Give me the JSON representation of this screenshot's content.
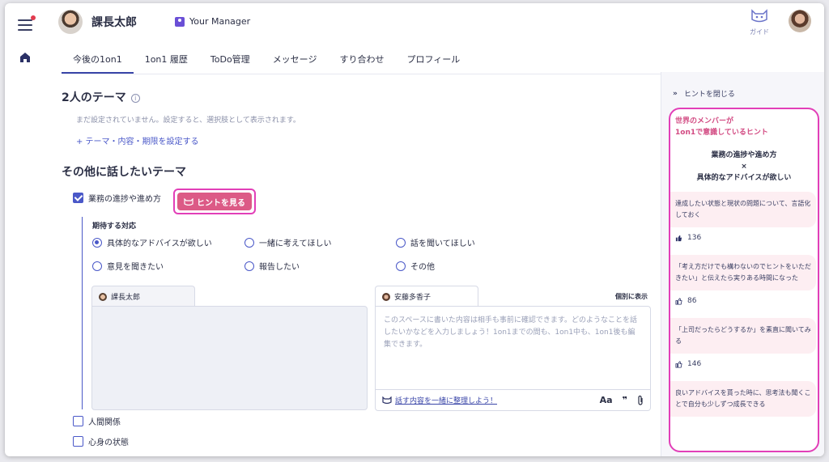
{
  "header": {
    "user_name": "課長太郎",
    "manager_label": "Your Manager",
    "guide_label": "ガイド"
  },
  "tabs": [
    {
      "label": "今後の1on1",
      "active": true
    },
    {
      "label": "1on1 履歴",
      "active": false
    },
    {
      "label": "ToDo管理",
      "active": false
    },
    {
      "label": "メッセージ",
      "active": false
    },
    {
      "label": "すり合わせ",
      "active": false
    },
    {
      "label": "プロフィール",
      "active": false
    }
  ],
  "theme_section": {
    "title": "2人のテーマ",
    "info_icon": "i",
    "empty_text": "まだ設定されていません。設定すると、選択肢として表示されます。",
    "set_link": "+ テーマ・内容・期限を設定する"
  },
  "other_section": {
    "title": "その他に話したいテーマ",
    "topics": [
      {
        "label": "業務の進捗や進め方",
        "checked": true
      },
      {
        "label": "人間関係",
        "checked": false
      },
      {
        "label": "心身の状態",
        "checked": false
      }
    ],
    "hint_button": "ヒントを見る",
    "expect_label": "期待する対応",
    "options": [
      {
        "label": "具体的なアドバイスが欲しい",
        "selected": true
      },
      {
        "label": "一緒に考えてほしい",
        "selected": false
      },
      {
        "label": "話を聞いてほしい",
        "selected": false
      },
      {
        "label": "意見を聞きたい",
        "selected": false
      },
      {
        "label": "報告したい",
        "selected": false
      },
      {
        "label": "その他",
        "selected": false
      }
    ]
  },
  "notes": {
    "left_author": "課長太郎",
    "right_author": "安藤多香子",
    "individual_label": "個別に表示",
    "placeholder": "このスペースに書いた内容は相手も事前に確認できます。どのようなことを話したいかなどを入力しましょう！1on1までの間も、1on1中も、1on1後も編集できます。",
    "organize_link": "話す内容を一緒に整理しよう！",
    "tool_font": "Aa",
    "tool_quote": "❞"
  },
  "hints": {
    "close_label": "ヒントを閉じる",
    "heading_line1": "世界のメンバーが",
    "heading_line2": "1on1で意識しているヒント",
    "topic_line1": "業務の進捗や進め方",
    "topic_line2": "×",
    "topic_line3": "具体的なアドバイスが欲しい",
    "items": [
      {
        "text": "達成したい状態と現状の問題について、言語化しておく",
        "likes": "136"
      },
      {
        "text": "「考え方だけでも構わないのでヒントをいただきたい」と伝えたら実りある時間になった",
        "likes": "86"
      },
      {
        "text": "「上司だったらどうするか」を素直に聞いてみる",
        "likes": "146"
      },
      {
        "text": "良いアドバイスを貰った時に、思考法も聞くことで自分も少しずつ成長できる",
        "likes": ""
      }
    ]
  },
  "colors": {
    "accent": "#4a58c8",
    "hint_pink": "#dc5a86",
    "highlight": "#e23fb8"
  }
}
